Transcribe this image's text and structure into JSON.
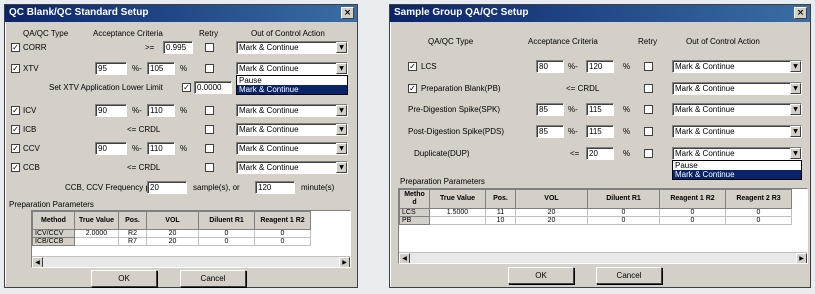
{
  "left": {
    "title": "QC Blank/QC Standard Setup",
    "headers": {
      "type": "QA/QC Type",
      "criteria": "Acceptance Criteria",
      "retry": "Retry",
      "action": "Out of Control Action"
    },
    "rows": {
      "corr": {
        "label": "CORR",
        "op": ">=",
        "value": "0.995",
        "action": "Mark & Continue"
      },
      "xtv": {
        "label": "XTV",
        "low": "95",
        "high": "105",
        "pct1": "%-",
        "pct2": "%",
        "action": "Mark & Continue"
      },
      "icv": {
        "label": "ICV",
        "low": "90",
        "high": "110",
        "pct1": "%-",
        "pct2": "%",
        "action": "Mark & Continue"
      },
      "icb": {
        "label": "ICB",
        "crit": "<= CRDL",
        "action": "Mark & Continue"
      },
      "ccv": {
        "label": "CCV",
        "low": "90",
        "high": "110",
        "pct1": "%-",
        "pct2": "%",
        "action": "Mark & Continue"
      },
      "ccb": {
        "label": "CCB",
        "crit": "<= CRDL",
        "action": "Mark & Continue"
      }
    },
    "xtv_lower_limit": {
      "label": "Set XTV Application Lower Limit",
      "value": "0.0000"
    },
    "dropdown_options": [
      "Pause",
      "Mark & Continue"
    ],
    "frequency": {
      "label": "CCB, CCV Frequency per",
      "samples": "20",
      "samples_unit": "sample(s), or",
      "minutes": "120",
      "minutes_unit": "minute(s)"
    },
    "prep_label": "Preparation Parameters",
    "table": {
      "headers": [
        "Method",
        "True Value",
        "Pos.",
        "VOL",
        "Diluent R1",
        "Reagent 1 R2"
      ],
      "rows": [
        [
          "ICV/CCV",
          "2.0000",
          "R2",
          "20",
          "0",
          "0"
        ],
        [
          "ICB/CCB",
          "",
          "R7",
          "20",
          "0",
          "0"
        ]
      ]
    },
    "ok": "OK",
    "cancel": "Cancel"
  },
  "right": {
    "title": "Sample Group QA/QC Setup",
    "headers": {
      "type": "QA/QC Type",
      "criteria": "Acceptance Criteria",
      "retry": "Retry",
      "action": "Out of Control Action"
    },
    "rows": {
      "lcs": {
        "label": "LCS",
        "low": "80",
        "high": "120",
        "pct1": "%-",
        "pct2": "%",
        "action": "Mark & Continue"
      },
      "pb": {
        "label": "Preparation Blank(PB)",
        "crit": "<= CRDL",
        "action": "Mark & Continue"
      },
      "spk": {
        "label": "Pre-Digestion Spike(SPK)",
        "low": "85",
        "high": "115",
        "pct1": "%-",
        "pct2": "%",
        "action": "Mark & Continue"
      },
      "pds": {
        "label": "Post-Digestion Spike(PDS)",
        "low": "85",
        "high": "115",
        "pct1": "%-",
        "pct2": "%",
        "action": "Mark & Continue"
      },
      "dup": {
        "label": "Duplicate(DUP)",
        "op": "<=",
        "value": "20",
        "pct": "%",
        "action": "Mark & Continue"
      }
    },
    "dropdown_options": [
      "Pause",
      "Mark & Continue"
    ],
    "prep_label": "Preparation Parameters",
    "table": {
      "headers": [
        "Metho d",
        "True Value",
        "Pos.",
        "VOL",
        "Diluent R1",
        "Reagent 1 R2",
        "Reagent 2 R3"
      ],
      "rows": [
        [
          "LCS",
          "1.5000",
          "11",
          "20",
          "0",
          "0",
          "0"
        ],
        [
          "PB",
          "",
          "10",
          "20",
          "0",
          "0",
          "0"
        ]
      ]
    },
    "ok": "OK",
    "cancel": "Cancel"
  },
  "glyphs": {
    "check": "✓",
    "close": "×",
    "arrow_down": "▼",
    "arrow_left": "◀",
    "arrow_right": "▶"
  }
}
